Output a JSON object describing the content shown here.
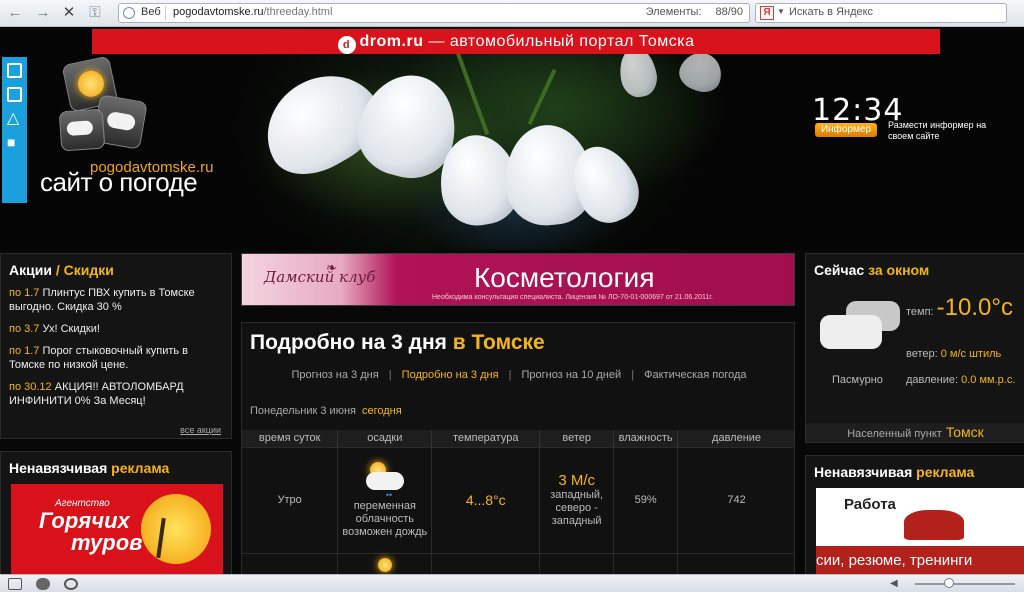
{
  "browser": {
    "scope_label": "Веб",
    "url_host": "pogodavtomske.ru",
    "url_path": "/threeday.html",
    "elements_label": "Элементы:",
    "elements_count": "88/90",
    "search_placeholder": "Искать в Яндекс",
    "search_engine_icon": "yandex-icon"
  },
  "header": {
    "drom_logo_letter": "d",
    "drom_brand": "drom.ru",
    "drom_text": " — автомобильный портал Томска",
    "site_domain": "pogodavtomske.ru",
    "site_title": "сайт о погоде",
    "clock": "12:34",
    "informer_button": "Информер",
    "informer_text": "Размести информер на своем сайте"
  },
  "promos": {
    "title_main": "Акции",
    "title_sep": " / ",
    "title_accent": "Скидки",
    "items": [
      {
        "date": "по 1.7",
        "text": " Плинтус ПВХ купить в Томске выгодно. Скидка 30 %"
      },
      {
        "date": "по 3.7",
        "text": " Ух! Скидки!"
      },
      {
        "date": "по 1.7",
        "text": " Порог стыковочный купить в Томске по низкой цене."
      },
      {
        "date": "по 30.12",
        "text": " АКЦИЯ!! АВТОЛОМБАРД ИНФИНИТИ 0% За Месяц!"
      }
    ],
    "all_link": "все акции"
  },
  "ads_left": {
    "title_main": "Ненавязчивая ",
    "title_accent": "реклама",
    "banner_top": "Агентство",
    "banner_line1": "Горячих",
    "banner_line2": "туров"
  },
  "cosmetology": {
    "club_name": "Дамский клуб",
    "title": "Косметология",
    "note": "Необходима консультация специалиста. Лицензия № ЛО-70-01-000697 от 21.06.2011г."
  },
  "forecast": {
    "title_main": "Подробно на 3 дня ",
    "title_accent": "в Томске",
    "tabs": [
      "Прогноз на 3 дня",
      "Подробно на 3 дня",
      "Прогноз на 10 дней",
      "Фактическая погода"
    ],
    "tab_separator": "|",
    "active_tab": 1,
    "date_text": "Понедельник  3 июня",
    "date_tag": "сегодня",
    "columns": [
      "время суток",
      "осадки",
      "температура",
      "ветер",
      "влажность",
      "давление"
    ],
    "rows": [
      {
        "time": "Утро",
        "precip": "переменная облачность возможен дождь",
        "temp": "4...8°c",
        "wind_speed": "3 М/с",
        "wind_dir": "западный, северо - западный",
        "humidity": "59%",
        "pressure": "742"
      }
    ]
  },
  "now": {
    "title_main": "Сейчас ",
    "title_accent": "за окном",
    "temp_label": "темп:",
    "temp_value": "-10.0°c",
    "wind_label": "ветер:",
    "wind_value": "0 м/с штиль",
    "condition": "Пасмурно",
    "pressure_label": "давление:",
    "pressure_value": "0.0 мм.р.с.",
    "settlement_label": "Населенный пункт",
    "settlement_value": "Томск"
  },
  "ads_right": {
    "title_main": "Ненавязчивая ",
    "title_accent": "реклама",
    "banner_title": "Работа",
    "banner_text": "сии, резюме, тренинги"
  },
  "colors": {
    "accent": "#f4b616",
    "drom_red": "#d8131b",
    "side_tab": "#1aa0dc",
    "cosmetology_pink": "#a10e4e"
  }
}
